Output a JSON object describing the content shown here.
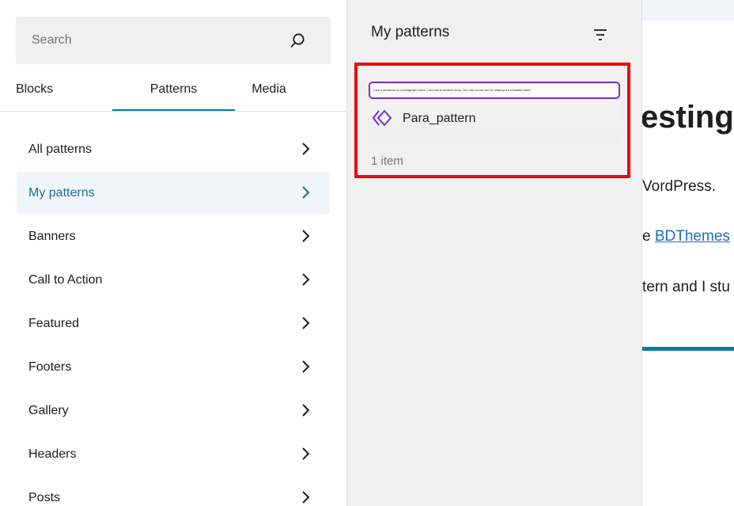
{
  "inserter": {
    "search": {
      "placeholder": "Search",
      "value": ""
    },
    "tabs": [
      {
        "label": "Blocks",
        "active": false
      },
      {
        "label": "Patterns",
        "active": true
      },
      {
        "label": "Media",
        "active": false
      }
    ],
    "categories": [
      {
        "label": "All patterns",
        "active": false
      },
      {
        "label": "My patterns",
        "active": true
      },
      {
        "label": "Banners",
        "active": false
      },
      {
        "label": "Call to Action",
        "active": false
      },
      {
        "label": "Featured",
        "active": false
      },
      {
        "label": "Footers",
        "active": false
      },
      {
        "label": "Gallery",
        "active": false
      },
      {
        "label": "Headers",
        "active": false
      },
      {
        "label": "Posts",
        "active": false
      }
    ]
  },
  "patterns_panel": {
    "title": "My patterns",
    "filter_icon": "filter-icon",
    "pattern": {
      "preview_text": "I am a sentence in a paragraph block. I am still a content block. You can re-use me by making it a reusable block.",
      "name": "Para_pattern",
      "icon": "synced-pattern-icon"
    },
    "item_count": "1 item"
  },
  "editor": {
    "heading_fragment": "esting",
    "line1": "VordPress.",
    "line2_prefix": "e ",
    "line2_link": "BDThemes",
    "line3": "tern and I stu"
  },
  "colors": {
    "accent": "#007cba",
    "active_text": "#1d6f99",
    "highlight_red": "#ec0a0a",
    "pattern_purple": "#7b2fce"
  }
}
